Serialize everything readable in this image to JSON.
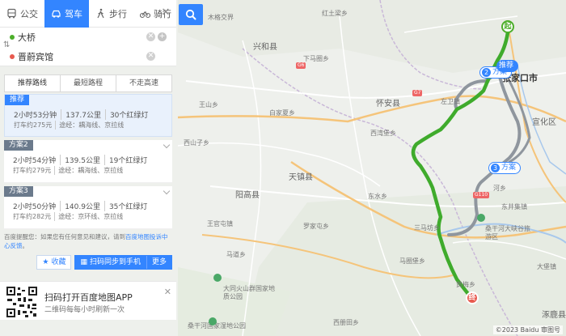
{
  "modes": [
    {
      "label": "公交",
      "icon": "bus-icon",
      "active": false
    },
    {
      "label": "驾车",
      "icon": "car-icon",
      "active": true
    },
    {
      "label": "步行",
      "icon": "walk-icon",
      "active": false
    },
    {
      "label": "骑行",
      "icon": "bike-icon",
      "active": false
    }
  ],
  "route_inputs": {
    "start": "大桥",
    "end": "晋蔚宾馆",
    "start_color": "#4cae2a",
    "end_color": "#e85a4f"
  },
  "tabs": [
    {
      "label": "推荐路线"
    },
    {
      "label": "最短路程"
    },
    {
      "label": "不走高速"
    }
  ],
  "plans": [
    {
      "tag": "推荐",
      "time": "2小时53分钟",
      "distance": "137.7公里",
      "lights": "30个红绿灯",
      "fare": "打车约275元",
      "via": "途经：耦海线、京拉线"
    },
    {
      "tag": "方案2",
      "time": "2小时54分钟",
      "distance": "139.5公里",
      "lights": "19个红绿灯",
      "fare": "打车约279元",
      "via": "途经：耦海线、京拉线"
    },
    {
      "tag": "方案3",
      "time": "2小时50分钟",
      "distance": "140.9公里",
      "lights": "35个红绿灯",
      "fare": "打车约282元",
      "via": "途经：京环线、京拉线"
    }
  ],
  "note": {
    "text": "百度提醒您：如果您有任何意见和建议，请到",
    "link": "百度地图投诉中心反馈",
    "tail": "。"
  },
  "actions": {
    "favorite": "收藏",
    "send_phone": "扫码同步到手机",
    "more": "更多"
  },
  "qr_card": {
    "title": "扫码打开百度地图APP",
    "subtitle": "二维码每每小时刷新一次"
  },
  "map": {
    "start_marker": "起",
    "end_marker": "终",
    "route_tags": [
      {
        "num": "2",
        "label": "方案",
        "main": false
      },
      {
        "label": "推荐",
        "main": true
      },
      {
        "num": "3",
        "label": "方案",
        "main": false
      }
    ],
    "city_label": "张家口市",
    "labels": {
      "l1": "木格交界",
      "l2": "红土梁乡",
      "l3": "兴和县",
      "l4": "下马圈乡",
      "l5": "怀安县",
      "l6": "白家夏乡",
      "l7": "王山乡",
      "l8": "左卫镇",
      "l9": "西湾堡乡",
      "l10": "宣化区",
      "l11": "天镇县",
      "l12": "阳高县",
      "l13": "东水乡",
      "l14": "罗家屯乡",
      "l15": "三马坊乡",
      "l16": "马圈堡乡",
      "l17": "东井集镇",
      "l18": "桑干河大峡谷旅游区",
      "l19": "大同火山群国家地质公园",
      "l20": "黄梅乡",
      "l21": "桑干河国家湿地公园",
      "l22": "大堡镇",
      "l23": "西山子乡",
      "l24": "王官屯镇",
      "l25": "马道乡",
      "l26": "西册田乡",
      "l27": "河乡",
      "l28": "涿鹿县"
    },
    "shields": [
      "G6",
      "G7",
      "G110"
    ],
    "copyright": "©2023 Baidu 审图号"
  }
}
